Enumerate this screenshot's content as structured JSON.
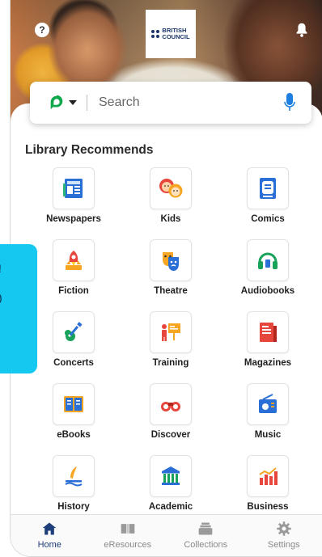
{
  "header": {
    "help_icon_text": "?",
    "logo_text_line1": "BRITISH",
    "logo_text_line2": "COUNCIL"
  },
  "search": {
    "placeholder": "Search",
    "accent_color": "#0fa84d",
    "mic_color": "#1f7fe0"
  },
  "library": {
    "title": "Library Recommends",
    "items": [
      {
        "label": "Newspapers",
        "icon": "newspaper-icon"
      },
      {
        "label": "Kids",
        "icon": "kids-icon"
      },
      {
        "label": "Comics",
        "icon": "comics-icon"
      },
      {
        "label": "Fiction",
        "icon": "rocket-icon"
      },
      {
        "label": "Theatre",
        "icon": "theatre-masks-icon"
      },
      {
        "label": "Audiobooks",
        "icon": "headphones-icon"
      },
      {
        "label": "Concerts",
        "icon": "guitar-icon"
      },
      {
        "label": "Training",
        "icon": "presentation-icon"
      },
      {
        "label": "Magazines",
        "icon": "magazine-icon"
      },
      {
        "label": "eBooks",
        "icon": "ebook-icon"
      },
      {
        "label": "Discover",
        "icon": "binoculars-icon"
      },
      {
        "label": "Music",
        "icon": "radio-icon"
      },
      {
        "label": "History",
        "icon": "quill-icon"
      },
      {
        "label": "Academic",
        "icon": "columns-icon"
      },
      {
        "label": "Business",
        "icon": "bar-chart-icon"
      }
    ]
  },
  "tabbar": {
    "tabs": [
      {
        "label": "Home",
        "icon": "home-icon",
        "active": true
      },
      {
        "label": "eResources",
        "icon": "book-open-icon",
        "active": false
      },
      {
        "label": "Collections",
        "icon": "stack-icon",
        "active": false
      },
      {
        "label": "Settings",
        "icon": "gear-icon",
        "active": false
      }
    ]
  },
  "side_tab": {
    "line1": "!",
    "line2": ")"
  }
}
